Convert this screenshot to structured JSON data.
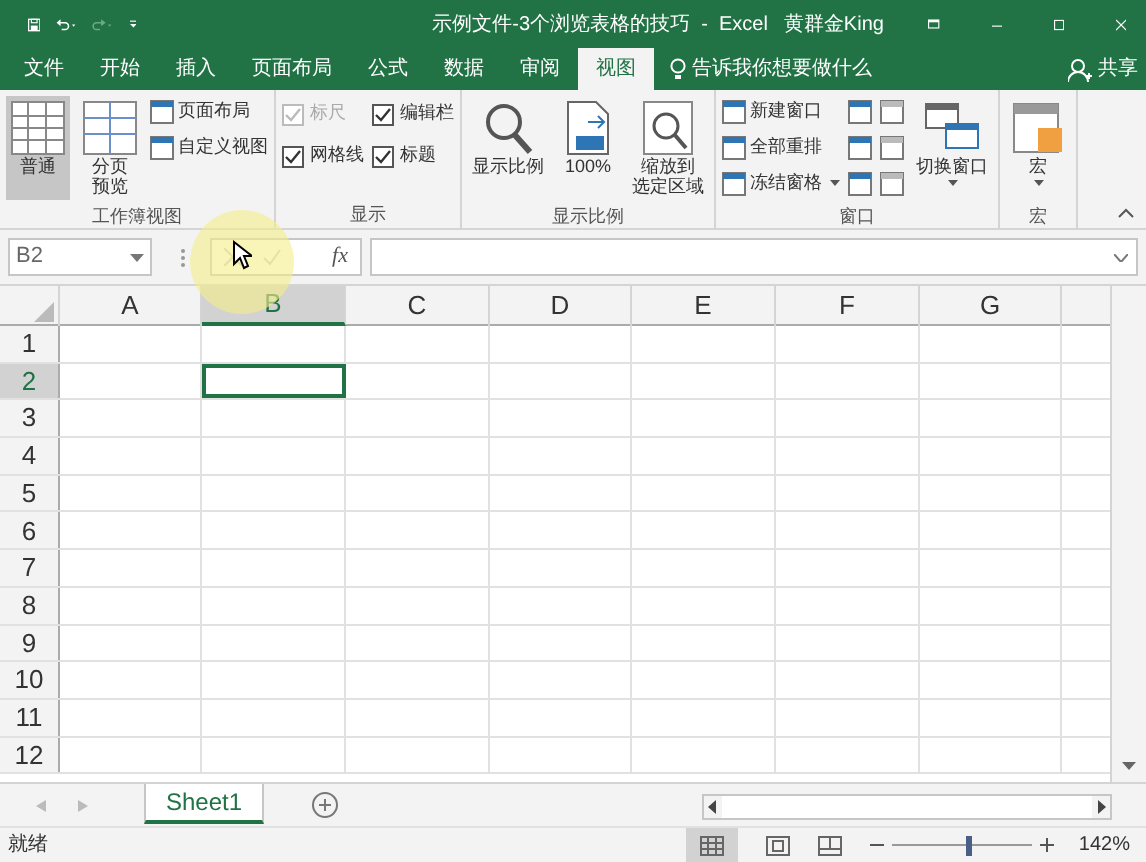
{
  "window": {
    "title": "示例文件-3个浏览表格的技巧  -  Excel",
    "user": "黄群金King"
  },
  "tabs": [
    {
      "label": "文件",
      "selected": false
    },
    {
      "label": "开始",
      "selected": false
    },
    {
      "label": "插入",
      "selected": false
    },
    {
      "label": "页面布局",
      "selected": false
    },
    {
      "label": "公式",
      "selected": false
    },
    {
      "label": "数据",
      "selected": false
    },
    {
      "label": "审阅",
      "selected": false
    },
    {
      "label": "视图",
      "selected": true
    }
  ],
  "tell_me": {
    "placeholder": "告诉我你想要做什么"
  },
  "share": "共享",
  "ribbon": {
    "groups": [
      {
        "label": "工作簿视图",
        "columns": [
          [
            {
              "kind": "large",
              "lines": [
                "普通"
              ],
              "selected": true,
              "dropdown": false
            }
          ],
          [
            {
              "kind": "large",
              "lines": [
                "分页",
                "预览"
              ],
              "selected": false,
              "dropdown": false
            }
          ],
          [
            {
              "kind": "small",
              "label": "页面布局",
              "dropdown": false
            },
            {
              "kind": "small",
              "label": "自定义视图",
              "dropdown": false
            }
          ]
        ]
      },
      {
        "label": "显示",
        "columns": [
          [
            {
              "kind": "check",
              "label": "标尺",
              "checked": true,
              "disabled": true
            },
            {
              "kind": "check",
              "label": "网格线",
              "checked": true,
              "disabled": false
            }
          ],
          [
            {
              "kind": "check",
              "label": "编辑栏",
              "checked": true,
              "disabled": false
            },
            {
              "kind": "check",
              "label": "标题",
              "checked": true,
              "disabled": false
            }
          ]
        ]
      },
      {
        "label": "显示比例",
        "columns": [
          [
            {
              "kind": "large",
              "lines": [
                "显示比例"
              ],
              "selected": false,
              "dropdown": false
            }
          ],
          [
            {
              "kind": "large",
              "lines": [
                "100%"
              ],
              "selected": false,
              "dropdown": false
            }
          ],
          [
            {
              "kind": "large",
              "lines": [
                "缩放到",
                "选定区域"
              ],
              "selected": false,
              "dropdown": false
            }
          ]
        ]
      },
      {
        "label": "窗口",
        "columns": [
          [
            {
              "kind": "small",
              "label": "新建窗口",
              "dropdown": false
            },
            {
              "kind": "small",
              "label": "全部重排",
              "dropdown": false
            },
            {
              "kind": "small",
              "label": "冻结窗格",
              "dropdown": true
            }
          ],
          [
            {
              "kind": "iconbtn",
              "disabled": false
            },
            {
              "kind": "iconbtn",
              "disabled": false
            },
            {
              "kind": "iconbtn",
              "disabled": false
            }
          ],
          [
            {
              "kind": "iconbtn",
              "disabled": true
            },
            {
              "kind": "iconbtn",
              "disabled": true
            },
            {
              "kind": "iconbtn",
              "disabled": true
            }
          ],
          [
            {
              "kind": "large",
              "lines": [
                "切换窗口"
              ],
              "selected": false,
              "dropdown": true
            }
          ]
        ]
      },
      {
        "label": "宏",
        "columns": [
          [
            {
              "kind": "large",
              "lines": [
                "宏"
              ],
              "selected": false,
              "dropdown": true
            }
          ]
        ]
      }
    ]
  },
  "formula_bar": {
    "name_box": "B2",
    "fx": "fx"
  },
  "sheet": {
    "columns": [
      {
        "label": "A",
        "selected": false
      },
      {
        "label": "B",
        "selected": true
      },
      {
        "label": "C",
        "selected": false
      },
      {
        "label": "D",
        "selected": false
      },
      {
        "label": "E",
        "selected": false
      },
      {
        "label": "F",
        "selected": false
      },
      {
        "label": "G",
        "selected": false
      }
    ],
    "rows": [
      {
        "label": "1",
        "selected": false
      },
      {
        "label": "2",
        "selected": true
      },
      {
        "label": "3",
        "selected": false
      },
      {
        "label": "4",
        "selected": false
      },
      {
        "label": "5",
        "selected": false
      },
      {
        "label": "6",
        "selected": false
      },
      {
        "label": "7",
        "selected": false
      },
      {
        "label": "8",
        "selected": false
      },
      {
        "label": "9",
        "selected": false
      },
      {
        "label": "10",
        "selected": false
      },
      {
        "label": "11",
        "selected": false
      },
      {
        "label": "12",
        "selected": false
      }
    ]
  },
  "sheet_tabs": [
    {
      "label": "Sheet1",
      "selected": true
    }
  ],
  "status_bar": {
    "status": "就绪",
    "zoom": {
      "level": 0.55,
      "reading": "142%"
    }
  }
}
